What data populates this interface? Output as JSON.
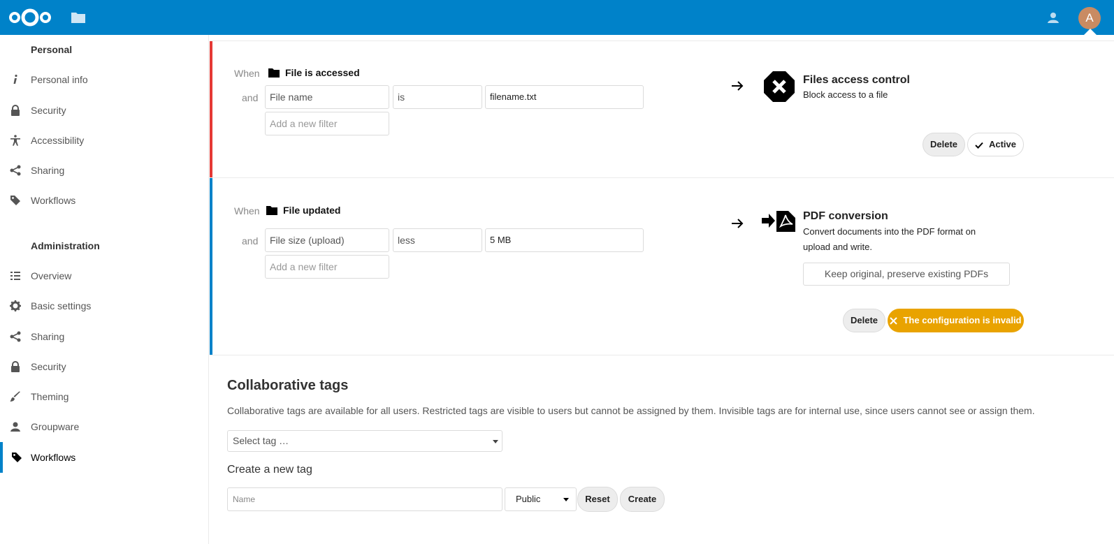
{
  "header": {
    "avatar_letter": "A",
    "brand_color": "#0082c9"
  },
  "sidebar": {
    "personal_heading": "Personal",
    "personal_items": [
      {
        "label": "Personal info",
        "icon": "info-icon"
      },
      {
        "label": "Security",
        "icon": "lock-icon"
      },
      {
        "label": "Accessibility",
        "icon": "accessibility-icon"
      },
      {
        "label": "Sharing",
        "icon": "share-icon"
      },
      {
        "label": "Workflows",
        "icon": "tag-icon"
      }
    ],
    "admin_heading": "Administration",
    "admin_items": [
      {
        "label": "Overview",
        "icon": "list-icon"
      },
      {
        "label": "Basic settings",
        "icon": "gear-icon"
      },
      {
        "label": "Sharing",
        "icon": "share-icon"
      },
      {
        "label": "Security",
        "icon": "lock-icon"
      },
      {
        "label": "Theming",
        "icon": "brush-icon"
      },
      {
        "label": "Groupware",
        "icon": "contacts-icon"
      },
      {
        "label": "Workflows",
        "icon": "tag-icon",
        "active": true
      }
    ]
  },
  "rules": [
    {
      "bar_color": "#e53935",
      "when_label": "When",
      "event": "File is accessed",
      "and_label": "and",
      "filter": {
        "field": "File name",
        "operator": "is",
        "value": "filename.txt"
      },
      "new_filter_placeholder": "Add a new filter",
      "operation_title": "Files access control",
      "operation_desc": "Block access to a file",
      "delete_label": "Delete",
      "status_label": "Active"
    },
    {
      "bar_color": "#0082c9",
      "when_label": "When",
      "event": "File updated",
      "and_label": "and",
      "filter": {
        "field": "File size (upload)",
        "operator": "less",
        "value": "5 MB"
      },
      "new_filter_placeholder": "Add a new filter",
      "operation_title": "PDF conversion",
      "operation_desc_1": "Convert documents into the PDF format on",
      "operation_desc_2": "upload and write.",
      "option_label": "Keep original, preserve existing PDFs",
      "delete_label": "Delete",
      "status_label": "The configuration is invalid",
      "status_color": "#e9a300"
    }
  ],
  "tags": {
    "title": "Collaborative tags",
    "description": "Collaborative tags are available for all users. Restricted tags are visible to users but cannot be assigned by them. Invisible tags are for internal use, since users cannot see or assign them.",
    "select_placeholder": "Select tag …",
    "new_tag_title": "Create a new tag",
    "name_placeholder": "Name",
    "visibility_value": "Public",
    "reset_label": "Reset",
    "create_label": "Create"
  }
}
